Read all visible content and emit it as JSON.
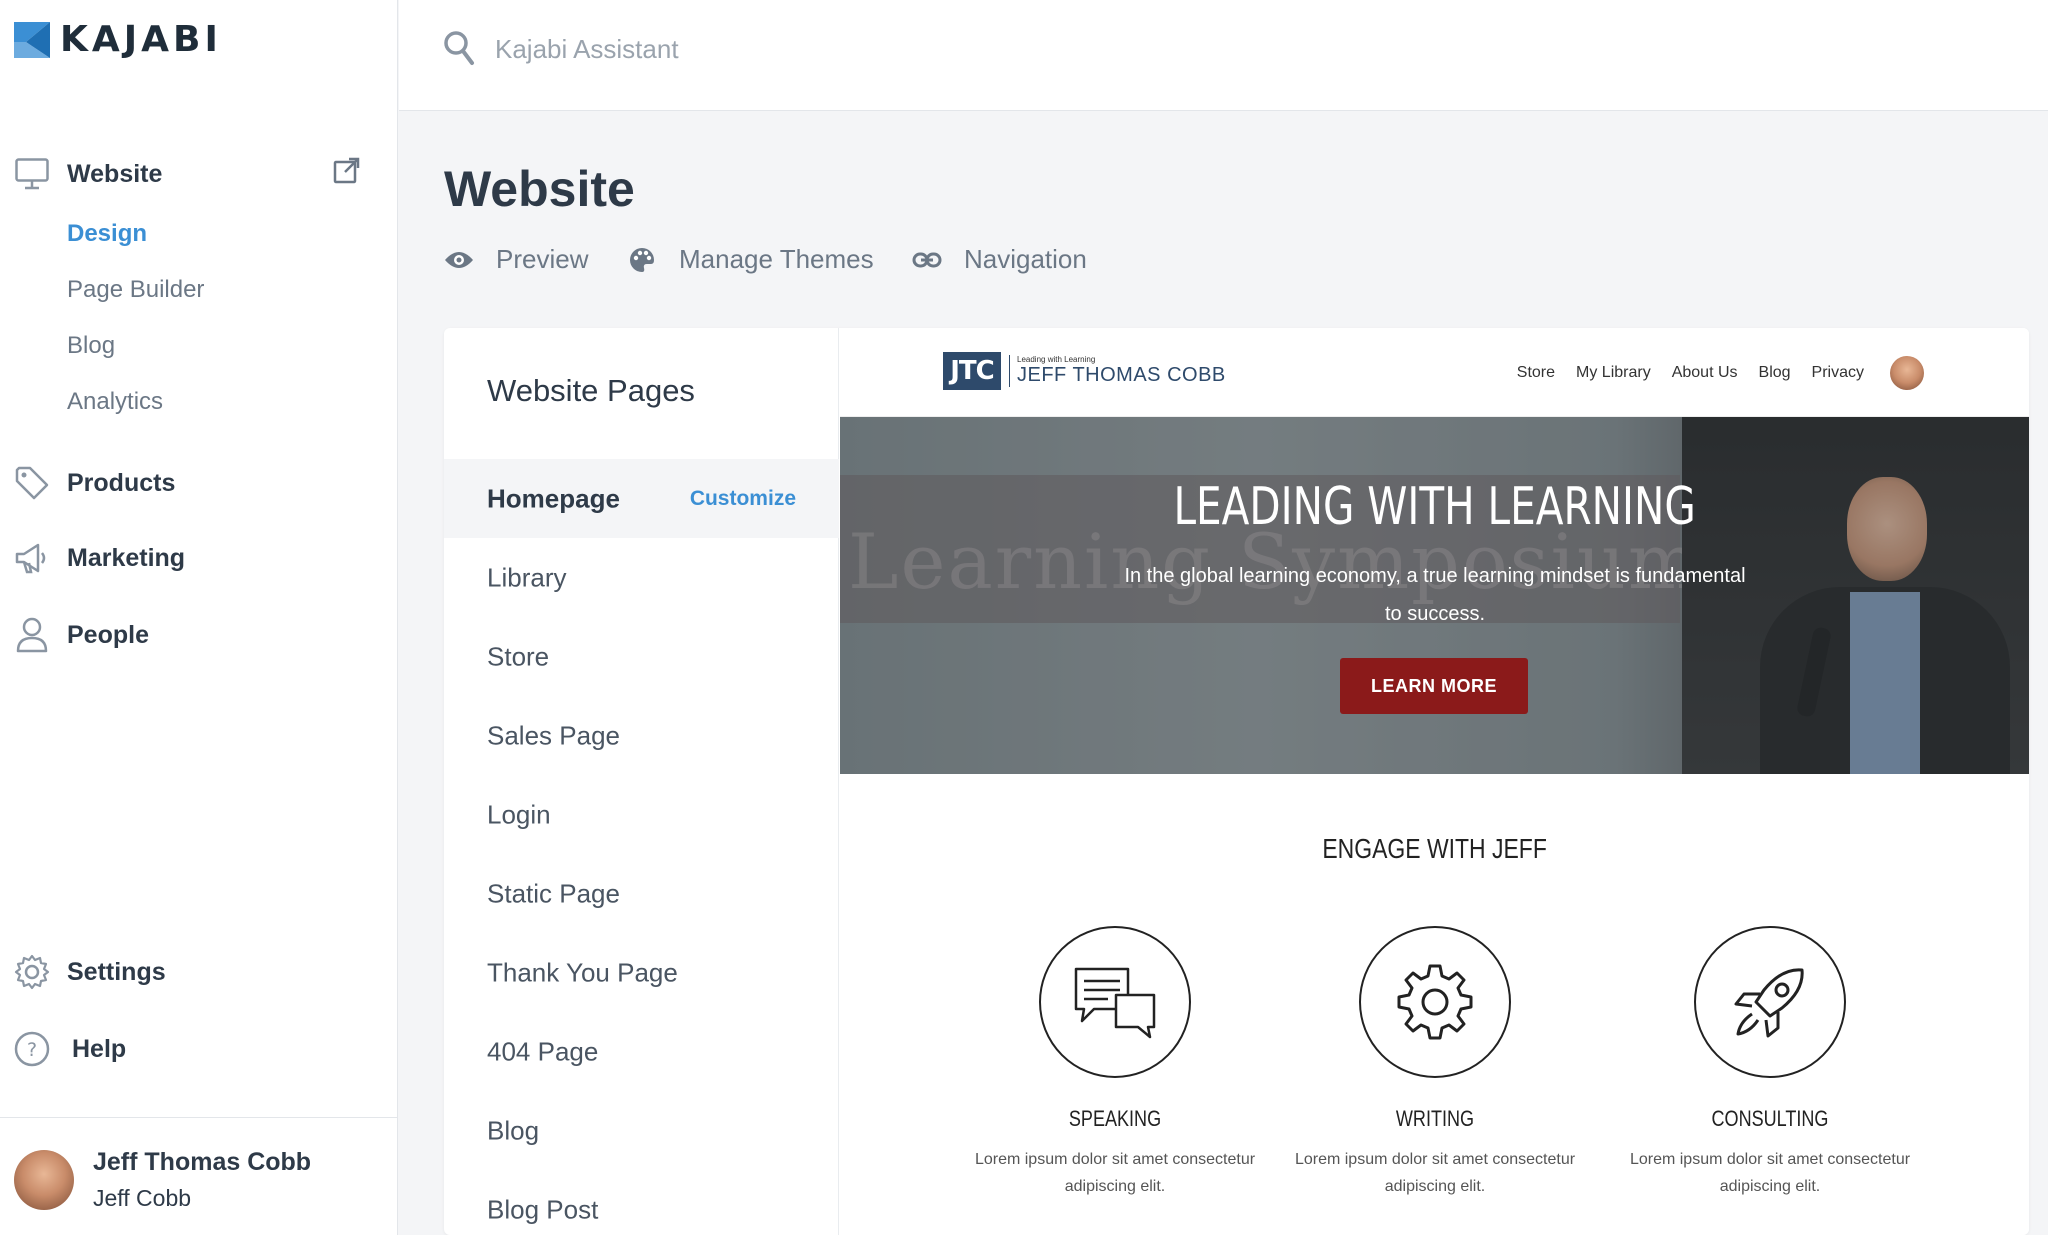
{
  "app": {
    "brand": "KAJABI",
    "accent_color": "#3b8fd4"
  },
  "sidebar": {
    "website": {
      "label": "Website",
      "icon": "monitor-icon"
    },
    "website_sub": [
      {
        "label": "Design",
        "active": true
      },
      {
        "label": "Page Builder",
        "active": false
      },
      {
        "label": "Blog",
        "active": false
      },
      {
        "label": "Analytics",
        "active": false
      }
    ],
    "items": [
      {
        "label": "Products",
        "icon": "tag-icon"
      },
      {
        "label": "Marketing",
        "icon": "megaphone-icon"
      },
      {
        "label": "People",
        "icon": "person-icon"
      }
    ],
    "bottom": [
      {
        "label": "Settings",
        "icon": "gear-icon"
      },
      {
        "label": "Help",
        "icon": "help-icon"
      }
    ],
    "user": {
      "name": "Jeff Thomas Cobb",
      "subtitle": "Jeff Cobb"
    }
  },
  "search": {
    "placeholder": "Kajabi Assistant",
    "value": ""
  },
  "main": {
    "title": "Website",
    "tools": [
      {
        "label": "Preview",
        "icon": "eye-icon"
      },
      {
        "label": "Manage Themes",
        "icon": "palette-icon"
      },
      {
        "label": "Navigation",
        "icon": "link-icon"
      }
    ]
  },
  "pages_panel": {
    "title": "Website Pages",
    "customize_label": "Customize",
    "pages": [
      {
        "label": "Homepage",
        "active": true
      },
      {
        "label": "Library",
        "active": false
      },
      {
        "label": "Store",
        "active": false
      },
      {
        "label": "Sales Page",
        "active": false
      },
      {
        "label": "Login",
        "active": false
      },
      {
        "label": "Static Page",
        "active": false
      },
      {
        "label": "Thank You Page",
        "active": false
      },
      {
        "label": "404 Page",
        "active": false
      },
      {
        "label": "Blog",
        "active": false
      },
      {
        "label": "Blog Post",
        "active": false
      }
    ]
  },
  "site_preview": {
    "logo_mark": "JTC",
    "logo_tagline": "Leading with Learning",
    "logo_name": "JEFF THOMAS COBB",
    "nav": [
      "Store",
      "My Library",
      "About Us",
      "Blog",
      "Privacy"
    ],
    "hero": {
      "background_text": "Learning Symposium",
      "title": "LEADING WITH LEARNING",
      "subtitle": "In the global learning economy, a true learning mindset is fundamental to success.",
      "button": "LEARN MORE",
      "button_color": "#8b1a1a"
    },
    "engage_title": "ENGAGE WITH JEFF",
    "features": [
      {
        "title": "SPEAKING",
        "icon": "chat-bubbles-icon",
        "desc": "Lorem ipsum dolor sit amet consectetur adipiscing elit."
      },
      {
        "title": "WRITING",
        "icon": "gear-icon",
        "desc": "Lorem ipsum dolor sit amet consectetur adipiscing elit."
      },
      {
        "title": "CONSULTING",
        "icon": "rocket-icon",
        "desc": "Lorem ipsum dolor sit amet consectetur adipiscing elit."
      }
    ]
  }
}
